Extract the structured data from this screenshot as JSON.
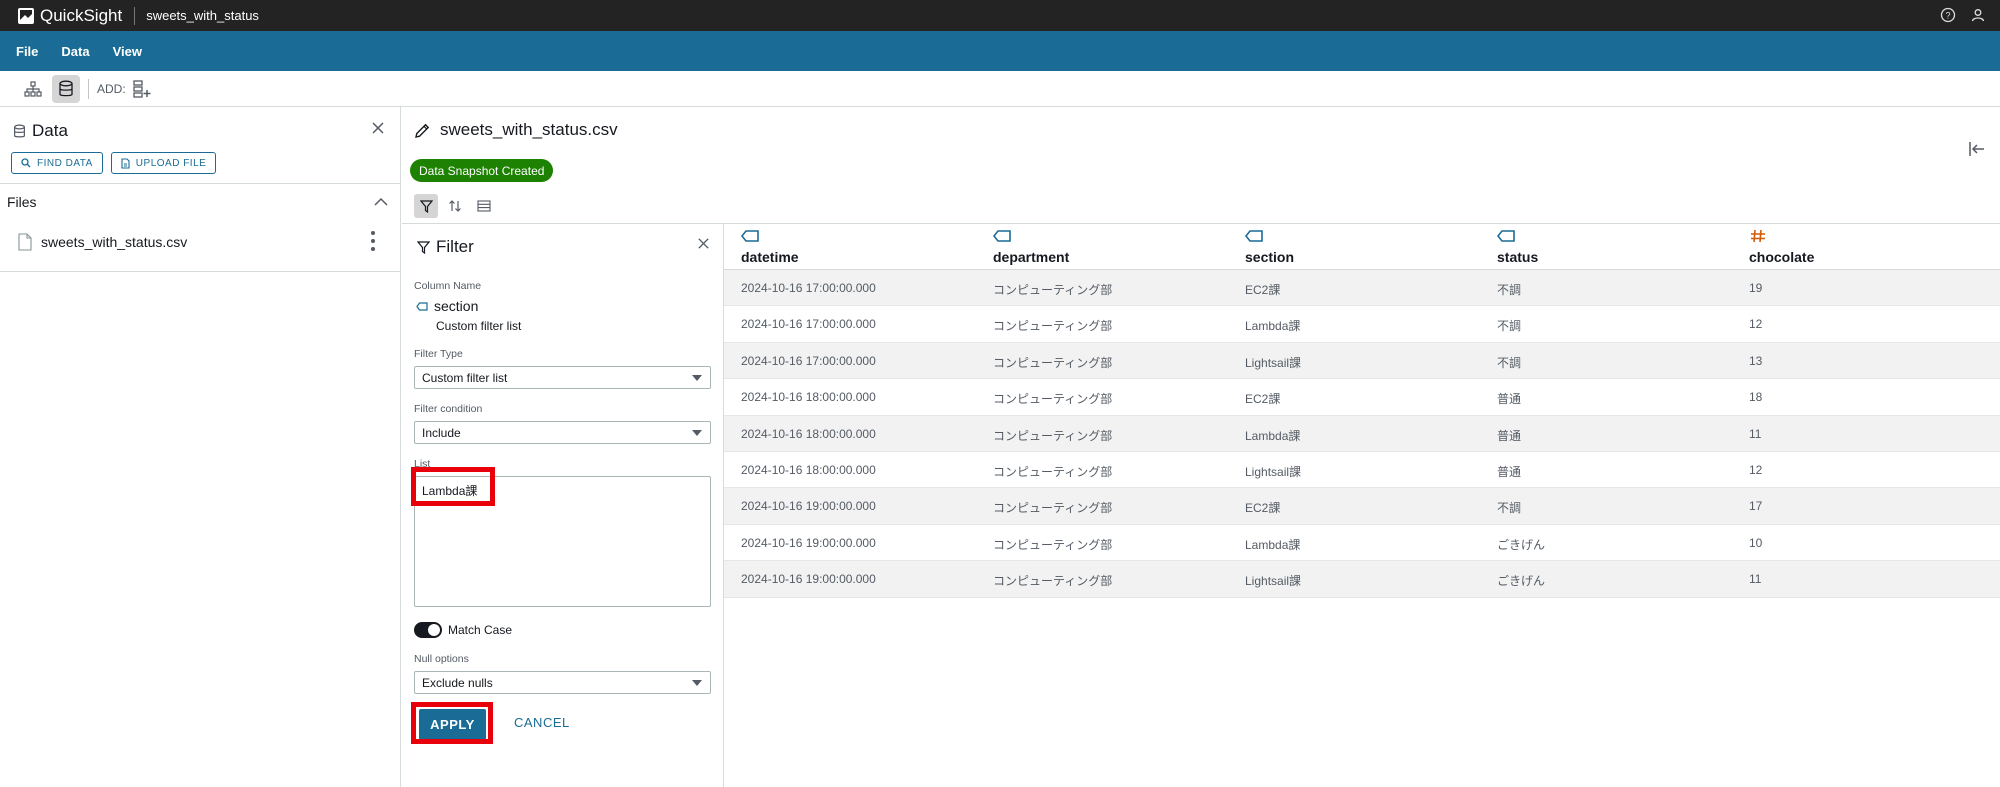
{
  "app": {
    "name": "QuickSight",
    "document": "sweets_with_status"
  },
  "menu": [
    "File",
    "Data",
    "View"
  ],
  "toolbar": {
    "add_label": "ADD:"
  },
  "left_panel": {
    "title": "Data",
    "find_data": "FIND DATA",
    "upload_file": "UPLOAD FILE",
    "files_label": "Files",
    "files": [
      "sweets_with_status.csv"
    ]
  },
  "main": {
    "title": "sweets_with_status.csv",
    "status_badge": "Data Snapshot Created"
  },
  "filter": {
    "title": "Filter",
    "column_name_label": "Column Name",
    "column_name": "section",
    "column_subtext": "Custom filter list",
    "filter_type_label": "Filter Type",
    "filter_type": "Custom filter list",
    "condition_label": "Filter condition",
    "condition": "Include",
    "list_label": "List",
    "list_value": "Lambda課",
    "match_case_label": "Match Case",
    "null_options_label": "Null options",
    "null_options": "Exclude nulls",
    "apply": "APPLY",
    "cancel": "CANCEL"
  },
  "table": {
    "columns": [
      {
        "label": "datetime",
        "type_icon": "string-tag-icon"
      },
      {
        "label": "department",
        "type_icon": "string-tag-icon"
      },
      {
        "label": "section",
        "type_icon": "string-tag-icon"
      },
      {
        "label": "status",
        "type_icon": "string-tag-icon"
      },
      {
        "label": "chocolate",
        "type_icon": "hash-icon"
      }
    ],
    "rows": [
      [
        "2024-10-16 17:00:00.000",
        "コンピューティング部",
        "EC2課",
        "不調",
        "19"
      ],
      [
        "2024-10-16 17:00:00.000",
        "コンピューティング部",
        "Lambda課",
        "不調",
        "12"
      ],
      [
        "2024-10-16 17:00:00.000",
        "コンピューティング部",
        "Lightsail課",
        "不調",
        "13"
      ],
      [
        "2024-10-16 18:00:00.000",
        "コンピューティング部",
        "EC2課",
        "普通",
        "18"
      ],
      [
        "2024-10-16 18:00:00.000",
        "コンピューティング部",
        "Lambda課",
        "普通",
        "11"
      ],
      [
        "2024-10-16 18:00:00.000",
        "コンピューティング部",
        "Lightsail課",
        "普通",
        "12"
      ],
      [
        "2024-10-16 19:00:00.000",
        "コンピューティング部",
        "EC2課",
        "不調",
        "17"
      ],
      [
        "2024-10-16 19:00:00.000",
        "コンピューティング部",
        "Lambda課",
        "ごきげん",
        "10"
      ],
      [
        "2024-10-16 19:00:00.000",
        "コンピューティング部",
        "Lightsail課",
        "ごきげん",
        "11"
      ]
    ]
  },
  "colors": {
    "topbar": "#232323",
    "menubar": "#1a6c96",
    "accent": "#1a6c96",
    "success": "#1d8102",
    "highlight": "#e8000b",
    "number_icon": "#d45b07"
  }
}
